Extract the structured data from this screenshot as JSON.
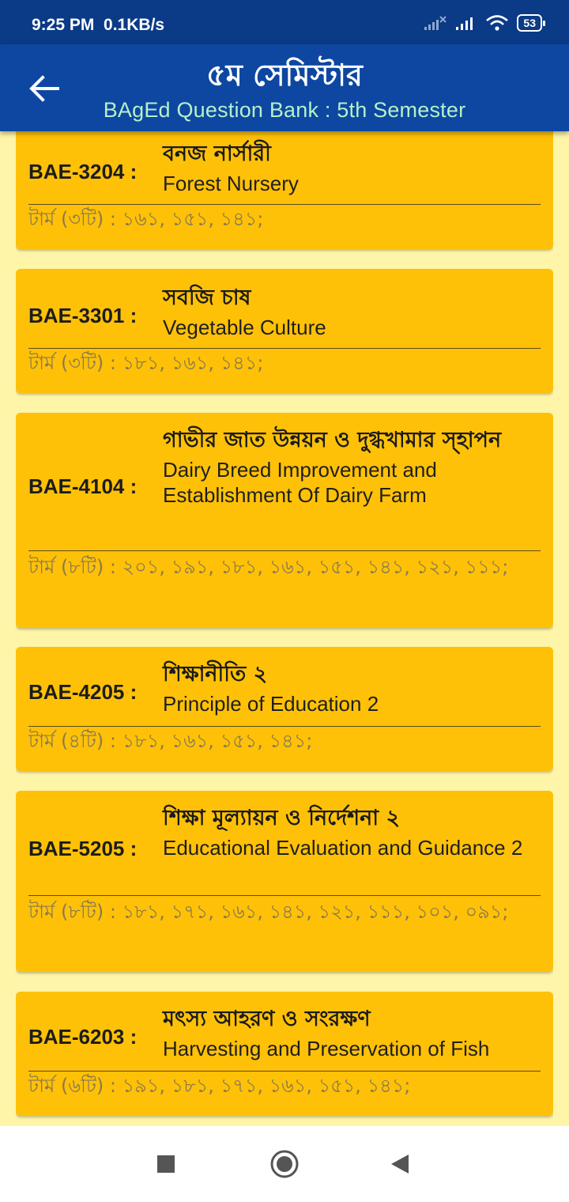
{
  "status": {
    "time": "9:25 PM",
    "speed": "0.1KB/s",
    "battery": "53",
    "icons": [
      "signal-off-icon",
      "signal-icon",
      "wifi-icon",
      "battery-icon"
    ]
  },
  "header": {
    "title": "৫ম সেমিস্টার",
    "subtitle": "BAgEd Question Bank : 5th Semester",
    "back_icon": "arrow-back-icon"
  },
  "colors": {
    "app_bar": "#0d47a1",
    "card": "#ffc107",
    "background": "#fff5a8",
    "subtitle": "#b7f0c8"
  },
  "courses": [
    {
      "code": "BAE-3204 :",
      "title_bn": "বনজ নার্সারী",
      "title_en": "Forest Nursery",
      "terms": "টার্ম (৩টি) : ১৬১, ১৫১, ১৪১;"
    },
    {
      "code": "BAE-3301 :",
      "title_bn": "সবজি চাষ",
      "title_en": "Vegetable Culture",
      "terms": "টার্ম (৩টি) : ১৮১, ১৬১, ১৪১;"
    },
    {
      "code": "BAE-4104 :",
      "title_bn": "গাভীর জাত উন্নয়ন ও দুগ্ধখামার স্হাপন",
      "title_en": "Dairy Breed Improvement and Establishment Of Dairy Farm",
      "terms": "টার্ম (৮টি) : ২০১, ১৯১, ১৮১, ১৬১, ১৫১, ১৪১, ১২১, ১১১;"
    },
    {
      "code": "BAE-4205 :",
      "title_bn": "শিক্ষানীতি ২",
      "title_en": "Principle of Education 2",
      "terms": "টার্ম (৪টি) : ১৮১, ১৬১, ১৫১, ১৪১;"
    },
    {
      "code": "BAE-5205 :",
      "title_bn": "শিক্ষা মূল্যায়ন ও নির্দেশনা ২",
      "title_en": "Educational Evaluation and Guidance 2",
      "terms": "টার্ম (৮টি) : ১৮১, ১৭১, ১৬১, ১৪১, ১২১, ১১১, ১০১, ০৯১;"
    },
    {
      "code": "BAE-6203 :",
      "title_bn": "মৎস্য আহরণ ও সংরক্ষণ",
      "title_en": "Harvesting and Preservation of Fish",
      "terms": "টার্ম (৬টি) : ১৯১, ১৮১, ১৭১, ১৬১, ১৫১, ১৪১;"
    }
  ],
  "nav": {
    "recents_icon": "square-recents-icon",
    "home_icon": "circle-home-icon",
    "back_icon": "triangle-back-icon"
  }
}
